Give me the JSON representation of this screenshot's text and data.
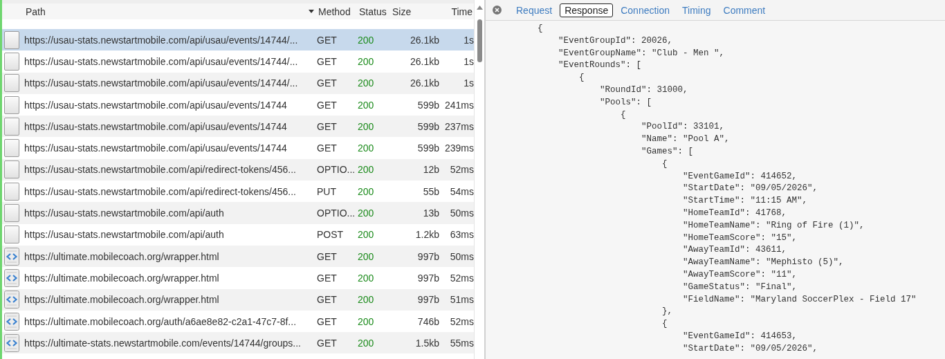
{
  "flow_table": {
    "columns": [
      "Path",
      "Method",
      "Status",
      "Size",
      "Time"
    ],
    "rows": [
      {
        "kind": "blank",
        "selected": true,
        "path": "https://usau-stats.newstartmobile.com/api/usau/events/14744/...",
        "method": "GET",
        "status": "200",
        "size": "26.1kb",
        "time": "1s"
      },
      {
        "kind": "blank",
        "selected": false,
        "path": "https://usau-stats.newstartmobile.com/api/usau/events/14744/...",
        "method": "GET",
        "status": "200",
        "size": "26.1kb",
        "time": "1s"
      },
      {
        "kind": "blank",
        "selected": false,
        "path": "https://usau-stats.newstartmobile.com/api/usau/events/14744/...",
        "method": "GET",
        "status": "200",
        "size": "26.1kb",
        "time": "1s"
      },
      {
        "kind": "blank",
        "selected": false,
        "path": "https://usau-stats.newstartmobile.com/api/usau/events/14744",
        "method": "GET",
        "status": "200",
        "size": "599b",
        "time": "241ms"
      },
      {
        "kind": "blank",
        "selected": false,
        "path": "https://usau-stats.newstartmobile.com/api/usau/events/14744",
        "method": "GET",
        "status": "200",
        "size": "599b",
        "time": "237ms"
      },
      {
        "kind": "blank",
        "selected": false,
        "path": "https://usau-stats.newstartmobile.com/api/usau/events/14744",
        "method": "GET",
        "status": "200",
        "size": "599b",
        "time": "239ms"
      },
      {
        "kind": "blank",
        "selected": false,
        "path": "https://usau-stats.newstartmobile.com/api/redirect-tokens/456...",
        "method": "OPTIO...",
        "status": "200",
        "size": "12b",
        "time": "52ms"
      },
      {
        "kind": "blank",
        "selected": false,
        "path": "https://usau-stats.newstartmobile.com/api/redirect-tokens/456...",
        "method": "PUT",
        "status": "200",
        "size": "55b",
        "time": "54ms"
      },
      {
        "kind": "blank",
        "selected": false,
        "path": "https://usau-stats.newstartmobile.com/api/auth",
        "method": "OPTIO...",
        "status": "200",
        "size": "13b",
        "time": "50ms"
      },
      {
        "kind": "blank",
        "selected": false,
        "path": "https://usau-stats.newstartmobile.com/api/auth",
        "method": "POST",
        "status": "200",
        "size": "1.2kb",
        "time": "63ms"
      },
      {
        "kind": "html",
        "selected": false,
        "path": "https://ultimate.mobilecoach.org/wrapper.html",
        "method": "GET",
        "status": "200",
        "size": "997b",
        "time": "50ms"
      },
      {
        "kind": "html",
        "selected": false,
        "path": "https://ultimate.mobilecoach.org/wrapper.html",
        "method": "GET",
        "status": "200",
        "size": "997b",
        "time": "52ms"
      },
      {
        "kind": "html",
        "selected": false,
        "path": "https://ultimate.mobilecoach.org/wrapper.html",
        "method": "GET",
        "status": "200",
        "size": "997b",
        "time": "51ms"
      },
      {
        "kind": "html",
        "selected": false,
        "path": "https://ultimate.mobilecoach.org/auth/a6ae8e82-c2a1-47c7-8f...",
        "method": "GET",
        "status": "200",
        "size": "746b",
        "time": "52ms"
      },
      {
        "kind": "html",
        "selected": false,
        "path": "https://ultimate-stats.newstartmobile.com/events/14744/groups...",
        "method": "GET",
        "status": "200",
        "size": "1.5kb",
        "time": "55ms"
      }
    ]
  },
  "detail": {
    "tabs": [
      {
        "label": "Request",
        "selected": false
      },
      {
        "label": "Response",
        "selected": true
      },
      {
        "label": "Connection",
        "selected": false
      },
      {
        "label": "Timing",
        "selected": false
      },
      {
        "label": "Comment",
        "selected": false
      }
    ],
    "response_lines": [
      "{",
      "    \"EventGroupId\": 20026,",
      "    \"EventGroupName\": \"Club - Men \",",
      "    \"EventRounds\": [",
      "        {",
      "            \"RoundId\": 31000,",
      "            \"Pools\": [",
      "                {",
      "                    \"PoolId\": 33101,",
      "                    \"Name\": \"Pool A\",",
      "                    \"Games\": [",
      "                        {",
      "                            \"EventGameId\": 414652,",
      "                            \"StartDate\": \"09/05/2026\",",
      "                            \"StartTime\": \"11:15 AM\",",
      "                            \"HomeTeamId\": 41768,",
      "                            \"HomeTeamName\": \"Ring of Fire (1)\",",
      "                            \"HomeTeamScore\": \"15\",",
      "                            \"AwayTeamId\": 43611,",
      "                            \"AwayTeamName\": \"Mephisto (5)\",",
      "                            \"AwayTeamScore\": \"11\",",
      "                            \"GameStatus\": \"Final\",",
      "                            \"FieldName\": \"Maryland SoccerPlex - Field 17\"",
      "                        },",
      "                        {",
      "                            \"EventGameId\": 414653,",
      "                            \"StartDate\": \"09/05/2026\","
    ]
  }
}
